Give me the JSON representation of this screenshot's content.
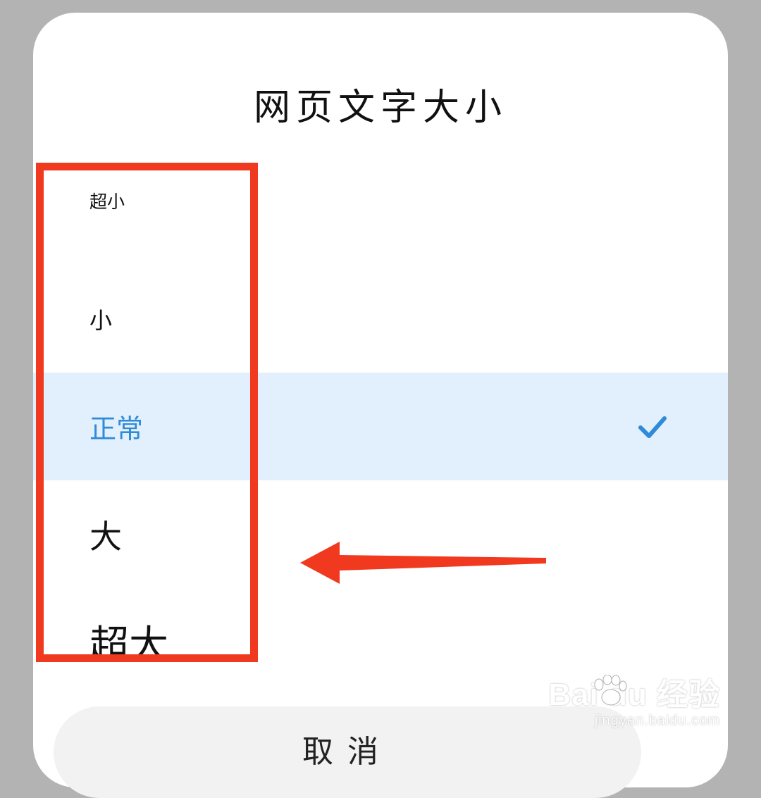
{
  "dialog": {
    "title": "网页文字大小",
    "options": [
      {
        "label": "超小",
        "selected": false
      },
      {
        "label": "小",
        "selected": false
      },
      {
        "label": "正常",
        "selected": true
      },
      {
        "label": "大",
        "selected": false
      },
      {
        "label": "超大",
        "selected": false
      }
    ],
    "cancel_label": "取消"
  },
  "annotation": {
    "box_color": "#f0391e",
    "arrow_color": "#f0391e"
  },
  "watermark": {
    "brand": "Bai du 经验",
    "url": "jingyan.baidu.com"
  },
  "colors": {
    "accent": "#2f8ad9",
    "selected_bg": "#e2f0fd",
    "backdrop": "#b3b3b3"
  },
  "icons": {
    "check": "check-icon",
    "arrow": "arrow-left-icon",
    "paw": "paw-icon"
  }
}
